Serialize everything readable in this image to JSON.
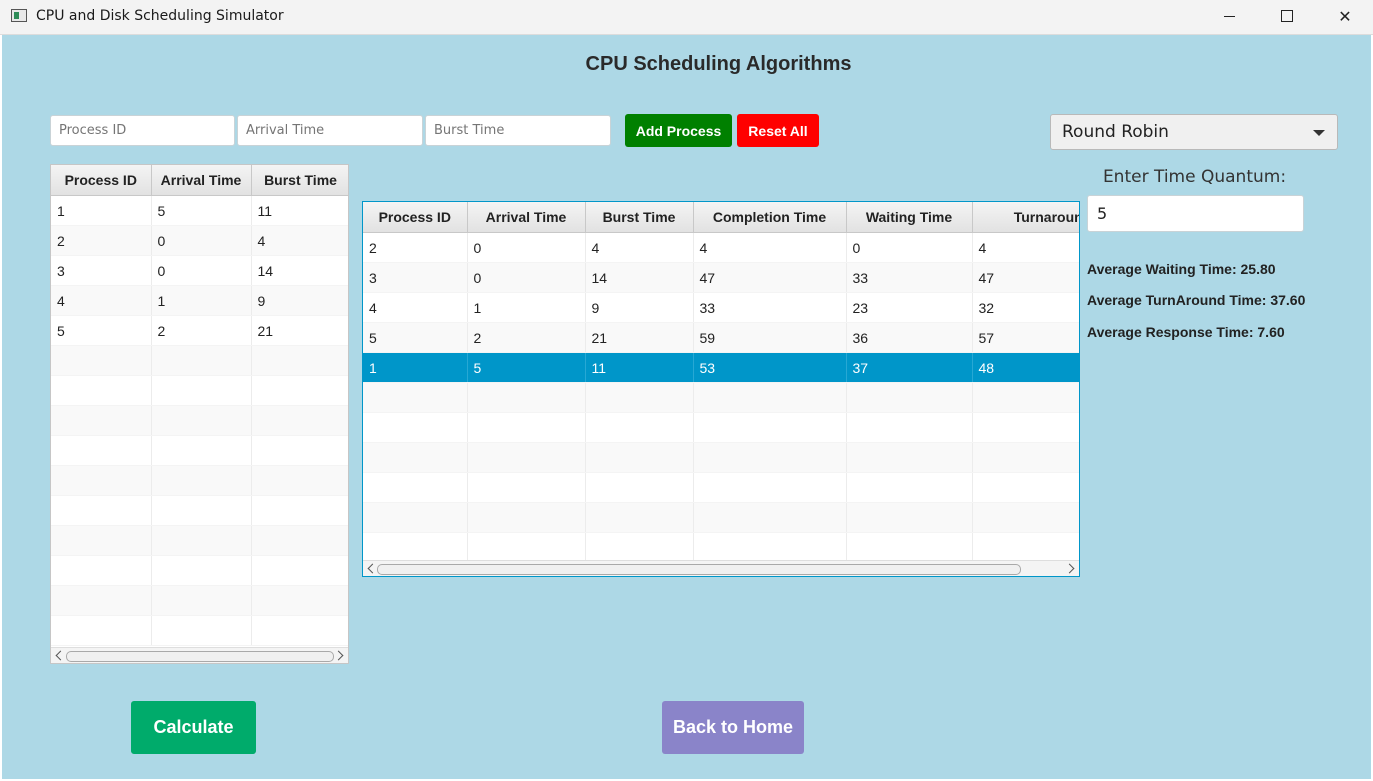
{
  "window": {
    "title": "CPU and Disk Scheduling Simulator"
  },
  "page": {
    "title": "CPU Scheduling Algorithms"
  },
  "inputs": {
    "process_id_placeholder": "Process ID",
    "arrival_time_placeholder": "Arrival Time",
    "burst_time_placeholder": "Burst Time"
  },
  "buttons": {
    "add_process": "Add Process",
    "reset_all": "Reset All",
    "calculate": "Calculate",
    "back_home": "Back to Home"
  },
  "algorithm_select": {
    "selected": "Round Robin"
  },
  "time_quantum": {
    "label": "Enter Time Quantum:",
    "value": "5"
  },
  "averages": {
    "waiting": "Average Waiting Time: 25.80",
    "turnaround": "Average TurnAround Time: 37.60",
    "response": "Average Response Time: 7.60"
  },
  "input_table": {
    "headers": [
      "Process ID",
      "Arrival Time",
      "Burst Time"
    ],
    "rows": [
      [
        "1",
        "5",
        "11"
      ],
      [
        "2",
        "0",
        "4"
      ],
      [
        "3",
        "0",
        "14"
      ],
      [
        "4",
        "1",
        "9"
      ],
      [
        "5",
        "2",
        "21"
      ]
    ]
  },
  "result_table": {
    "headers": [
      "Process ID",
      "Arrival Time",
      "Burst Time",
      "Completion Time",
      "Waiting Time",
      "Turnaround"
    ],
    "rows": [
      [
        "2",
        "0",
        "4",
        "4",
        "0",
        "4"
      ],
      [
        "3",
        "0",
        "14",
        "47",
        "33",
        "47"
      ],
      [
        "4",
        "1",
        "9",
        "33",
        "23",
        "32"
      ],
      [
        "5",
        "2",
        "21",
        "59",
        "36",
        "57"
      ],
      [
        "1",
        "5",
        "11",
        "53",
        "37",
        "48"
      ]
    ],
    "selected_row": 4
  }
}
